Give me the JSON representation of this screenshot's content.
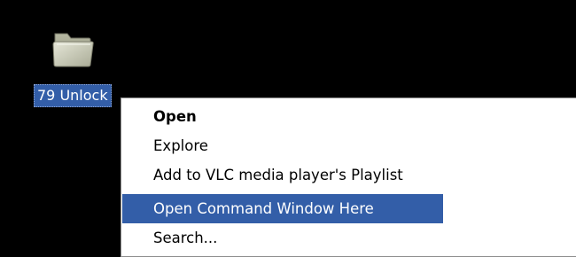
{
  "desktop": {
    "folder": {
      "label": "79 Unlock",
      "icon": "folder-icon"
    }
  },
  "context_menu": {
    "items": [
      {
        "label": "Open",
        "bold": true,
        "highlighted": false
      },
      {
        "label": "Explore",
        "bold": false,
        "highlighted": false
      },
      {
        "label": "Add to VLC media player's Playlist",
        "bold": false,
        "highlighted": false
      },
      {
        "label": "Open Command Window Here",
        "bold": false,
        "highlighted": true
      },
      {
        "label": "Search...",
        "bold": false,
        "highlighted": false
      }
    ]
  },
  "colors": {
    "desktop_background": "#000000",
    "selection_highlight": "#335ea8",
    "menu_background": "#ffffff",
    "folder_color": "#c8c9b4"
  }
}
